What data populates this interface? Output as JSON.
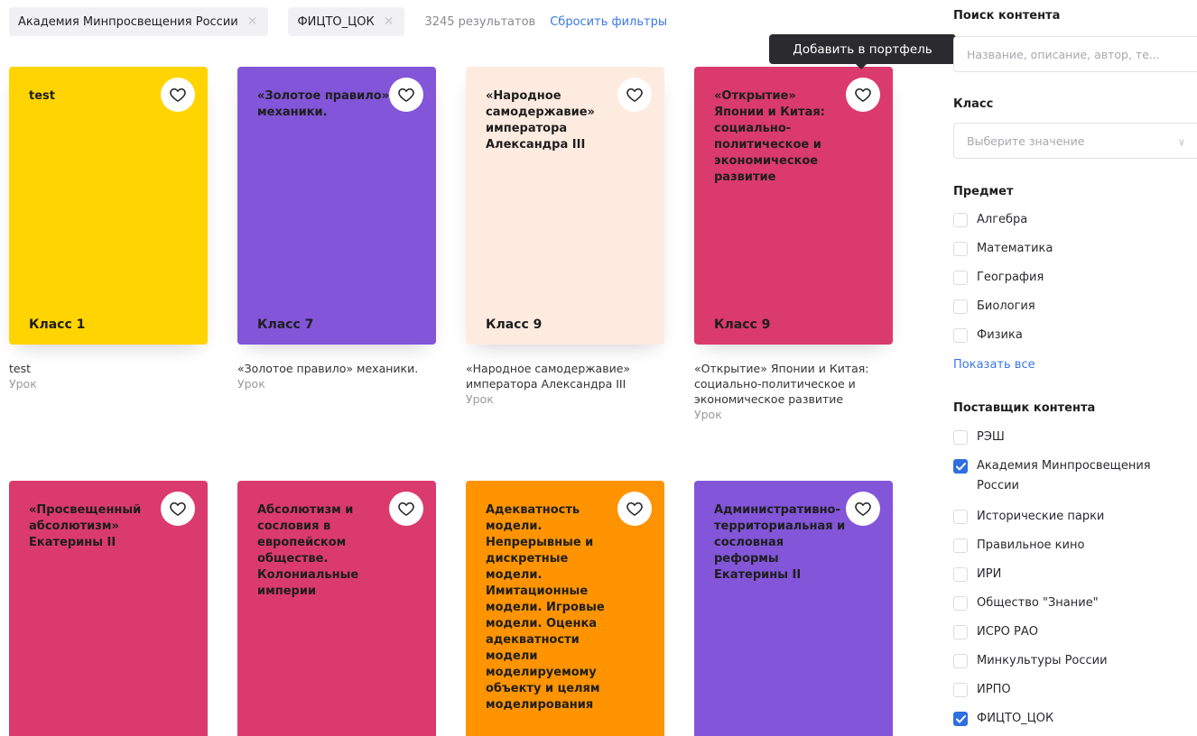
{
  "filters": {
    "chips": [
      {
        "label": "Академия Минпросвещения России"
      },
      {
        "label": "ФИЦТО_ЦОК"
      }
    ],
    "result_count": "3245 результатов",
    "reset_label": "Сбросить фильтры",
    "chip_close_glyph": "✕"
  },
  "tooltip": "Добавить в портфель",
  "cards": [
    {
      "cover_title": "test",
      "class_label": "Класс 1",
      "color": "#FFD400",
      "name": "test",
      "type": "Урок"
    },
    {
      "cover_title": "«Золотое правило» механики.",
      "class_label": "Класс 7",
      "color": "#8255D9",
      "name": "«Золотое правило» механики.",
      "type": "Урок"
    },
    {
      "cover_title": "«Народное самодержавие» императора Александра III",
      "class_label": "Класс 9",
      "color": "#FEEBE0",
      "name": "«Народное самодержавие» императора Александра III",
      "type": "Урок"
    },
    {
      "cover_title": "«Открытие» Японии и Китая: социально-политическое и экономическое развитие",
      "class_label": "Класс 9",
      "color": "#DB3A6E",
      "name": "«Открытие» Японии и Китая: социально-политическое и экономическое развитие",
      "type": "Урок"
    },
    {
      "cover_title": "«Просвещенный абсолютизм» Екатерины II",
      "class_label": "",
      "color": "#DB3A6E"
    },
    {
      "cover_title": "Абсолютизм и сословия в европейском обществе. Колониальные империи",
      "class_label": "",
      "color": "#DB3A6E"
    },
    {
      "cover_title": "Адекватность модели. Непрерывные и дискретные модели. Имитационные модели. Игровые модели. Оценка адекватности модели моделируемому объекту и целям моделирования",
      "class_label": "",
      "color": "#FF9400"
    },
    {
      "cover_title": "Административно-территориальная и сословная реформы Екатерины II",
      "class_label": "",
      "color": "#8255D9"
    }
  ],
  "sidebar": {
    "search_title": "Поиск контента",
    "search_placeholder": "Название, описание, автор, те...",
    "class_title": "Класс",
    "class_placeholder": "Выберите значение",
    "subject_title": "Предмет",
    "subjects": [
      {
        "label": "Алгебра",
        "checked": false
      },
      {
        "label": "Математика",
        "checked": false
      },
      {
        "label": "География",
        "checked": false
      },
      {
        "label": "Биология",
        "checked": false
      },
      {
        "label": "Физика",
        "checked": false
      }
    ],
    "show_all": "Показать все",
    "provider_title": "Поставщик контента",
    "providers": [
      {
        "label": "РЭШ",
        "checked": false
      },
      {
        "label": "Академия Минпросвещения России",
        "checked": true
      },
      {
        "label": "Исторические парки",
        "checked": false
      },
      {
        "label": "Правильное кино",
        "checked": false
      },
      {
        "label": "ИРИ",
        "checked": false
      },
      {
        "label": "Общество \"Знание\"",
        "checked": false
      },
      {
        "label": "ИСРО РАО",
        "checked": false
      },
      {
        "label": "Минкультуры России",
        "checked": false
      },
      {
        "label": "ИРПО",
        "checked": false
      },
      {
        "label": "ФИЦТО_ЦОК",
        "checked": true
      }
    ]
  }
}
